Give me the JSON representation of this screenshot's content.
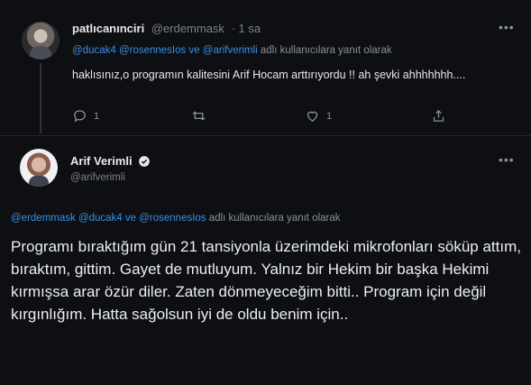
{
  "reply_tweet": {
    "display_name": "patlıcanınciri",
    "handle": "@erdemmask",
    "time": "· 1 sa",
    "replying_to": {
      "mentions": "@ducak4 @rosennesIos ve @arifverimli",
      "suffix": "adlı kullanıcılara yanıt olarak"
    },
    "text": "haklısınız,o programın kalitesini Arif Hocam arttırıyordu !! ah şevki ahhhhhhh....",
    "actions": {
      "reply_count": "1",
      "retweet_count": "",
      "like_count": "1"
    },
    "icons": [
      "comment-icon",
      "retweet-icon",
      "heart-icon",
      "share-icon",
      "more-icon"
    ]
  },
  "main_tweet": {
    "display_name": "Arif Verimli",
    "handle": "@arifverimli",
    "verified": true,
    "replying_to": {
      "mentions": "@erdemmask @ducak4 ve @rosennesIos",
      "suffix": "adlı kullanıcılara yanıt olarak"
    },
    "text": "Programı bıraktığım gün 21 tansiyonla üzerimdeki mikrofonları söküp attım, bıraktım, gittim. Gayet de mutluyum. Yalnız bir Hekim bir başka Hekimi kırmışsa arar özür diler. Zaten dönmeyeceğim bitti.. Program için değil kırgınlığım. Hatta sağolsun iyi de oldu benim için..",
    "icons": [
      "verified-badge-icon",
      "more-icon"
    ]
  },
  "colors": {
    "background": "#0d0f12",
    "text": "#e7e9ea",
    "muted": "#8b9196",
    "mention": "#3a8ee6",
    "verified": "#e7e9ea"
  }
}
